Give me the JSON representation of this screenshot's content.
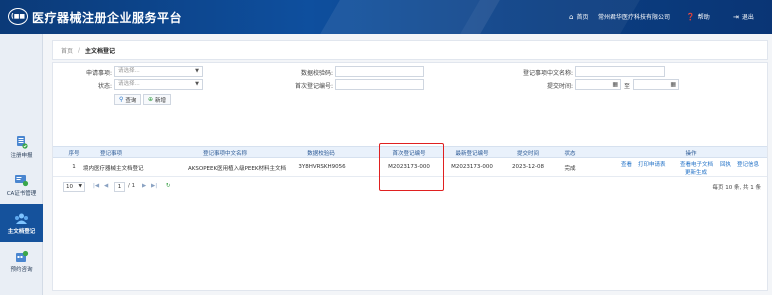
{
  "header": {
    "logo_text": "(■■",
    "title": "医疗器械注册企业服务平台",
    "nav": [
      {
        "icon": "home-icon",
        "glyph": "⌂",
        "label": "首页"
      },
      {
        "icon": "company-icon",
        "glyph": "",
        "label": "常州君华医疗科技有限公司"
      },
      {
        "icon": "help-icon",
        "glyph": "❓",
        "label": "帮助"
      },
      {
        "icon": "logout-icon",
        "glyph": "⇥",
        "label": "退出"
      }
    ]
  },
  "sidebar": {
    "items": [
      {
        "label": "注册申报",
        "icon": "document-upload-icon",
        "active": false
      },
      {
        "label": "CA证书管理",
        "icon": "ca-certificate-icon",
        "active": false
      },
      {
        "label": "主文档登记",
        "icon": "master-file-icon",
        "active": true
      },
      {
        "label": "预约咨询",
        "icon": "appointment-icon",
        "active": false
      }
    ]
  },
  "breadcrumb": {
    "home": "首页",
    "sep": "/",
    "current": "主文档登记"
  },
  "filters": {
    "apply_item": {
      "label": "申请事项:",
      "placeholder": "请选择..."
    },
    "status": {
      "label": "状态:",
      "placeholder": "请选择..."
    },
    "data_check_code": {
      "label": "数据校验码:",
      "value": ""
    },
    "first_reg_no": {
      "label": "首次登记编号:",
      "value": ""
    },
    "reg_item_cn_name": {
      "label": "登记事项中文名称:",
      "value": ""
    },
    "submit_time": {
      "label": "提交时间:",
      "to": "至"
    },
    "search_label": "查询",
    "add_label": "新增"
  },
  "table": {
    "headers": [
      "序号",
      "登记事项",
      "登记事项中文名称",
      "数据校验码",
      "首次登记编号",
      "最新登记编号",
      "提交时间",
      "状态",
      "操作"
    ],
    "rows": [
      {
        "index": "1",
        "item": "境内医疗器械主文档登记",
        "cn_name": "AKSOPEEK医用植入级PEEK材料主文档",
        "check_code": "3Y8HVRSKH9056",
        "first_no": "M2023173-000",
        "latest_no": "M2023173-000",
        "submit_time": "2023-12-08",
        "status": "完成",
        "actions": [
          "查看",
          "打印申请表",
          "查看电子文档",
          "回执",
          "登记信息",
          "更新生成"
        ]
      }
    ]
  },
  "pager": {
    "page_size": "10",
    "first": "|◀",
    "prev": "◀",
    "current": "1",
    "total": "/ 1",
    "next": "▶",
    "last": "▶|",
    "refresh": "↻",
    "info": "每页 10 条, 共 1 条"
  },
  "colors": {
    "header_bg": "#0e4f9e",
    "sidebar_active": "#15529c",
    "link": "#1e6fc6",
    "highlight": "#e02020"
  }
}
